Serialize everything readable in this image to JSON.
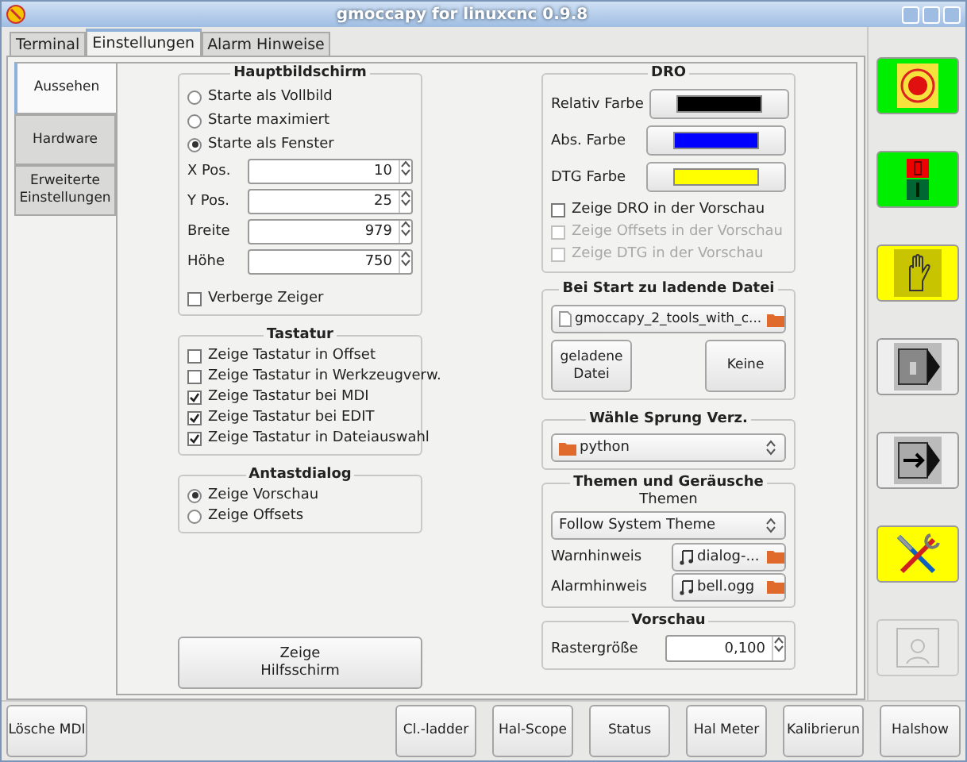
{
  "window": {
    "title": "gmoccapy for linuxcnc 0.9.8"
  },
  "tabs": [
    {
      "label": "Terminal",
      "selected": false
    },
    {
      "label": "Einstellungen",
      "selected": true
    },
    {
      "label": "Alarm Hinweise",
      "selected": false
    }
  ],
  "side_tabs": [
    {
      "label": "Aussehen",
      "selected": true
    },
    {
      "label": "Hardware",
      "selected": false
    },
    {
      "label": "Erweiterte Einstellungen",
      "selected": false
    }
  ],
  "hauptbildschirm": {
    "title": "Hauptbildschirm",
    "options": [
      {
        "label": "Starte als Vollbild",
        "selected": false
      },
      {
        "label": "Starte maximiert",
        "selected": false
      },
      {
        "label": "Starte als Fenster",
        "selected": true
      }
    ],
    "fields": [
      {
        "label": "X Pos.",
        "value": "10"
      },
      {
        "label": "Y Pos.",
        "value": "25"
      },
      {
        "label": "Breite",
        "value": "979"
      },
      {
        "label": "Höhe",
        "value": "750"
      }
    ],
    "hide_pointer": {
      "label": "Verberge Zeiger",
      "checked": false
    }
  },
  "tastatur": {
    "title": "Tastatur",
    "items": [
      {
        "label": "Zeige Tastatur in Offset",
        "checked": false
      },
      {
        "label": "Zeige Tastatur in Werkzeugverw.",
        "checked": false
      },
      {
        "label": "Zeige Tastatur bei MDI",
        "checked": true
      },
      {
        "label": "Zeige Tastatur bei EDIT",
        "checked": true
      },
      {
        "label": "Zeige Tastatur in Dateiauswahl",
        "checked": true
      }
    ]
  },
  "antastdialog": {
    "title": "Antastdialog",
    "options": [
      {
        "label": "Zeige Vorschau",
        "selected": true
      },
      {
        "label": "Zeige Offsets",
        "selected": false
      }
    ]
  },
  "help_button": "Zeige\nHilfsschirm",
  "dro": {
    "title": "DRO",
    "colors": [
      {
        "label": "Relativ Farbe",
        "color": "#000000"
      },
      {
        "label": "Abs. Farbe",
        "color": "#0000ff"
      },
      {
        "label": "DTG Farbe",
        "color": "#ffff00"
      }
    ],
    "checks": [
      {
        "label": "Zeige DRO in der Vorschau",
        "checked": false,
        "disabled": false
      },
      {
        "label": "Zeige Offsets in der Vorschau",
        "checked": false,
        "disabled": true
      },
      {
        "label": "Zeige DTG in der Vorschau",
        "checked": false,
        "disabled": true
      }
    ]
  },
  "start_file": {
    "title": "Bei Start zu ladende Datei",
    "file": "gmoccapy_2_tools_with_c...",
    "buttons": [
      "geladene\nDatei",
      "Keine"
    ]
  },
  "jump_dir": {
    "title": "Wähle Sprung Verz.",
    "value": "python"
  },
  "themes": {
    "title": "Themen und Geräusche",
    "theme_label": "Themen",
    "theme_value": "Follow System Theme",
    "sounds": [
      {
        "label": "Warnhinweis",
        "file": "dialog-..."
      },
      {
        "label": "Alarmhinweis",
        "file": "bell.ogg"
      }
    ]
  },
  "preview": {
    "title": "Vorschau",
    "grid_label": "Rastergröße",
    "grid_value": "0,100"
  },
  "side_buttons": [
    {
      "kind": "estop",
      "color": "#00ee00",
      "disabled": false
    },
    {
      "kind": "power",
      "color": "#00ee00",
      "disabled": false
    },
    {
      "kind": "hand",
      "color": "#ffff00",
      "disabled": false
    },
    {
      "kind": "manual",
      "color": "#eeeeee",
      "disabled": false
    },
    {
      "kind": "arrow",
      "color": "#eeeeee",
      "disabled": false
    },
    {
      "kind": "tools",
      "color": "#ffff00",
      "disabled": false
    },
    {
      "kind": "user",
      "color": "#eeeeee",
      "disabled": true
    }
  ],
  "bottom_buttons": [
    "Lösche MDI",
    "Cl.-ladder",
    "Hal-Scope",
    "Status",
    "Hal Meter",
    "Kalibrierun",
    "Halshow"
  ]
}
